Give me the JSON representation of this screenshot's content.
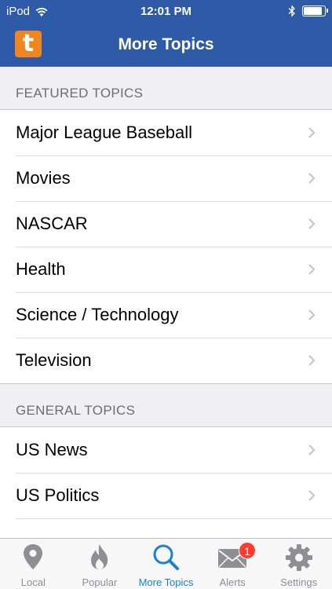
{
  "status": {
    "carrier": "iPod",
    "time": "12:01 PM",
    "battery_level": 0.9
  },
  "header": {
    "title": "More Topics",
    "logo_letter": "t"
  },
  "featured": {
    "heading": "FEATURED TOPICS",
    "items": [
      "Major League Baseball",
      "Movies",
      "NASCAR",
      "Health",
      "Science / Technology",
      "Television"
    ]
  },
  "general": {
    "heading": "GENERAL TOPICS",
    "items": [
      "US News",
      "US Politics"
    ]
  },
  "tabs": [
    {
      "label": "Local",
      "icon": "location-pin-icon"
    },
    {
      "label": "Popular",
      "icon": "flame-icon"
    },
    {
      "label": "More Topics",
      "icon": "search-icon"
    },
    {
      "label": "Alerts",
      "icon": "envelope-icon",
      "badge": "1"
    },
    {
      "label": "Settings",
      "icon": "gear-icon"
    }
  ],
  "colors": {
    "nav": "#2f5aa7",
    "accent": "#1a7fd9",
    "logo": "#f0861f",
    "badge": "#ff3b30"
  }
}
